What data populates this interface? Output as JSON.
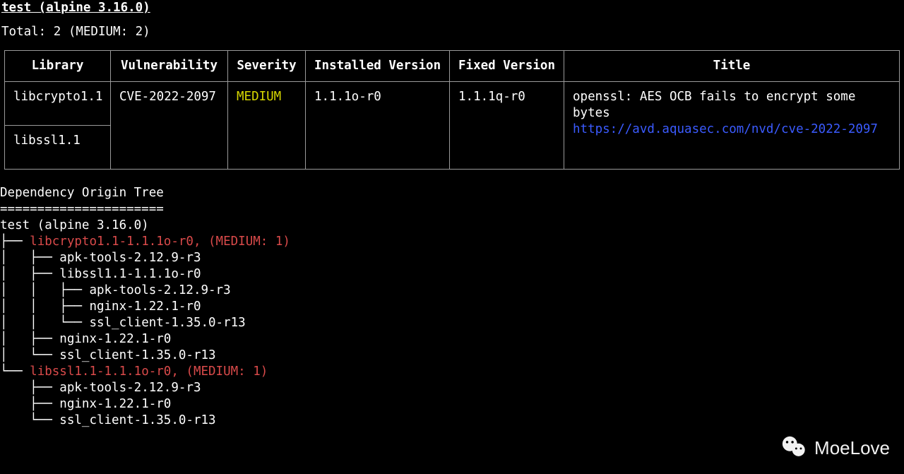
{
  "header": "test (alpine 3.16.0)",
  "total_line": "Total: 2 (MEDIUM: 2)",
  "table": {
    "headers": {
      "library": "Library",
      "vulnerability": "Vulnerability",
      "severity": "Severity",
      "installed": "Installed Version",
      "fixed": "Fixed Version",
      "title": "Title"
    },
    "rows": [
      {
        "library": "libcrypto1.1",
        "vulnerability": "CVE-2022-2097",
        "severity": "MEDIUM",
        "installed": "1.1.1o-r0",
        "fixed": "1.1.1q-r0",
        "title": "openssl: AES OCB fails to encrypt some bytes",
        "link": "https://avd.aquasec.com/nvd/cve-2022-2097"
      },
      {
        "library": "libssl1.1"
      }
    ]
  },
  "depTree": {
    "heading": "Dependency Origin Tree",
    "rule": "======================",
    "root": "test (alpine 3.16.0)",
    "l1a": "libcrypto1.1-1.1.1o-r0, (MEDIUM: 1)",
    "l1a_c1": "apk-tools-2.12.9-r3",
    "l1a_c2": "libssl1.1-1.1.1o-r0",
    "l1a_c2_c1": "apk-tools-2.12.9-r3",
    "l1a_c2_c2": "nginx-1.22.1-r0",
    "l1a_c2_c3": "ssl_client-1.35.0-r13",
    "l1a_c3": "nginx-1.22.1-r0",
    "l1a_c4": "ssl_client-1.35.0-r13",
    "l1b": "libssl1.1-1.1.1o-r0, (MEDIUM: 1)",
    "l1b_c1": "apk-tools-2.12.9-r3",
    "l1b_c2": "nginx-1.22.1-r0",
    "l1b_c3": "ssl_client-1.35.0-r13"
  },
  "watermark": {
    "text": "MoeLove"
  }
}
